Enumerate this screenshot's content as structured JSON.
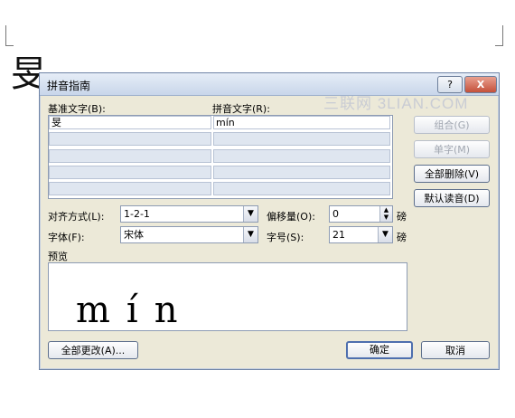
{
  "document": {
    "character": "旻"
  },
  "dialog": {
    "title": "拼音指南",
    "help_label": "?",
    "close_label": "X",
    "base_text_label": "基准文字(B):",
    "pinyin_text_label": "拼音文字(R):",
    "rows": [
      {
        "base": "旻",
        "pinyin": "mín"
      },
      {
        "base": "",
        "pinyin": ""
      },
      {
        "base": "",
        "pinyin": ""
      },
      {
        "base": "",
        "pinyin": ""
      },
      {
        "base": "",
        "pinyin": ""
      }
    ],
    "side_buttons": {
      "combine": "组合(G)",
      "single_char": "单字(M)",
      "clear_all": "全部删除(V)",
      "default_reading": "默认读音(D)"
    },
    "alignment_label": "对齐方式(L):",
    "alignment_value": "1-2-1",
    "offset_label": "偏移量(O):",
    "offset_value": "0",
    "offset_unit": "磅",
    "font_label": "字体(F):",
    "font_value": "宋体",
    "size_label": "字号(S):",
    "size_value": "21",
    "size_unit": "磅",
    "preview_label": "预览",
    "preview_text": "mín",
    "change_all_button": "全部更改(A)...",
    "ok_button": "确定",
    "cancel_button": "取消"
  },
  "watermark": "三联网 3LIAN.COM"
}
